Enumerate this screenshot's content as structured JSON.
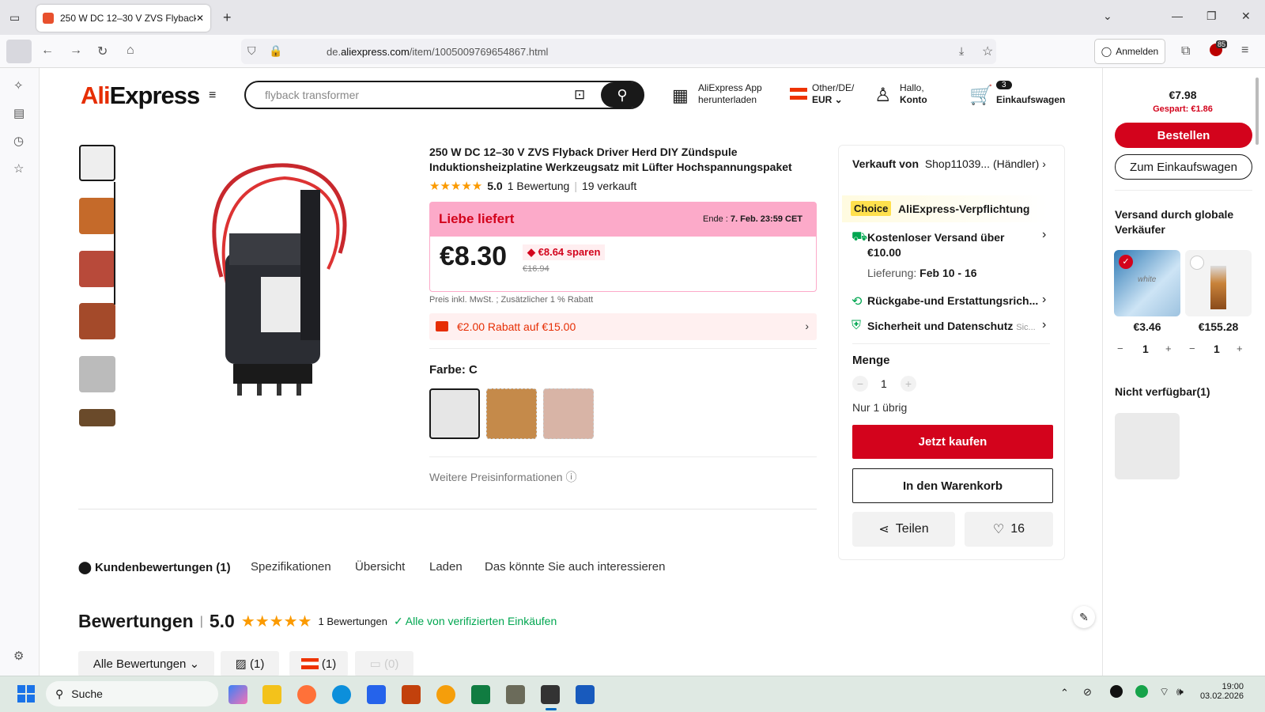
{
  "browser": {
    "tab_title": "250 W DC 12–30 V ZVS Flyback",
    "url_host": "de.",
    "url_domain": "aliexpress.com",
    "url_path": "/item/1005009769654867.html",
    "signin": "Anmelden",
    "ext_badge": "85"
  },
  "header": {
    "logo_a": "Ali",
    "logo_b": "Express",
    "search_placeholder": "flyback transformer",
    "app_line1": "AliExpress App",
    "app_line2": "herunterladen",
    "region_line1": "Other/DE/",
    "region_line2": "EUR",
    "account_line1": "Hallo,",
    "account_line2": "Konto",
    "cart_count": "3",
    "cart_label": "Einkaufswagen"
  },
  "product": {
    "title": "250 W DC 12–30 V ZVS Flyback Driver Herd DIY Zündspule Induktionsheizplatine Werkzeugsatz mit Lüfter Hochspannungspaket",
    "rating": "5.0",
    "reviews": "1 Bewertung",
    "sold": "19 verkauft",
    "promo": "Liebe liefert",
    "end_label": "Ende :",
    "end_date": "7. Feb. 23:59 CET",
    "price": "€8.30",
    "save": "€8.64 sparen",
    "old_price": "€16.94",
    "tax_note": "Preis inkl. MwSt. ; Zusätzlicher 1 % Rabatt",
    "coupon": "€2.00 Rabatt auf €15.00",
    "color_label": "Farbe: C",
    "more_price_info": "Weitere Preisinformationen"
  },
  "buybox": {
    "seller_label": "Verkauft von",
    "seller": "Shop11039... (Händler)",
    "choice": "Choice",
    "commitment": "AliExpress-Verpflichtung",
    "shipping_line1": "Kostenloser Versand über",
    "shipping_line2": "€10.00",
    "delivery_label": "Lieferung:",
    "delivery": "Feb 10 - 16",
    "returns": "Rückgabe-und Erstattungsrich...",
    "security": "Sicherheit und Datenschutz",
    "security_more": "Sic...",
    "qty_label": "Menge",
    "qty": "1",
    "stock": "Nur 1 übrig",
    "buy_now": "Jetzt kaufen",
    "add_cart": "In den Warenkorb",
    "share": "Teilen",
    "wish_count": "16"
  },
  "rpanel": {
    "total": "€7.98",
    "saved": "Gespart: €1.86",
    "order": "Bestellen",
    "to_cart": "Zum Einkaufswagen",
    "section": "Versand durch globale Verkäufer",
    "item1_price": "€3.46",
    "item1_qty": "1",
    "item1_label": "white",
    "item2_price": "€155.28",
    "item2_qty": "1",
    "unavailable": "Nicht verfügbar(1)"
  },
  "tabs": [
    "Kundenbewertungen (1)",
    "Spezifikationen",
    "Übersicht",
    "Laden",
    "Das könnte Sie auch interessieren"
  ],
  "reviews": {
    "title": "Bewertungen",
    "score": "5.0",
    "count": "1 Bewertungen",
    "verified": "Alle von verifizierten Einkäufen",
    "filter_all": "Alle Bewertungen",
    "filter_photo": "(1)",
    "filter_country": "(1)",
    "filter_comment": "(0)"
  },
  "taskbar": {
    "search": "Suche",
    "time": "19:00",
    "date": "03.02.2026"
  },
  "colors": {
    "accent": "#d3031c",
    "star": "#fb9a00",
    "choice": "#ffe04d",
    "verified": "#00a650"
  }
}
